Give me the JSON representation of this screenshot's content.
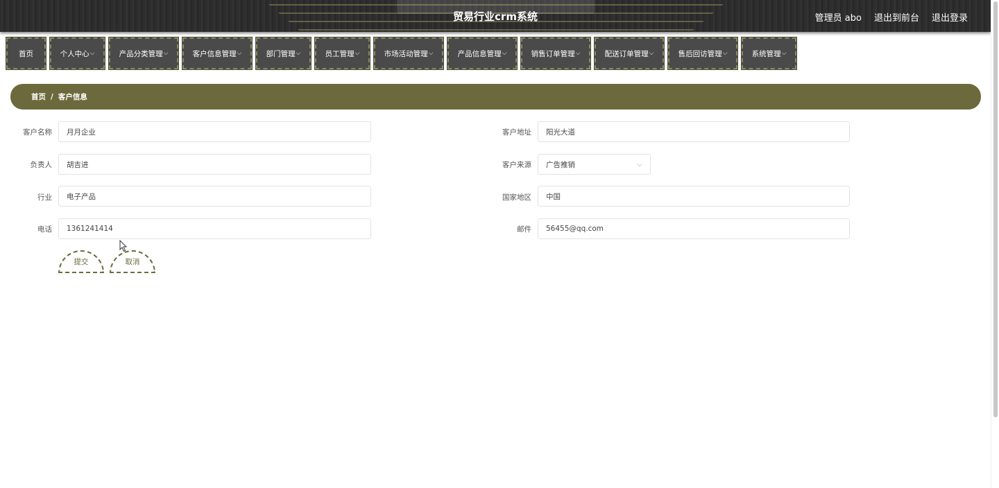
{
  "header": {
    "title": "贸易行业crm系统",
    "admin_label": "管理员 abo",
    "back_to_front": "退出到前台",
    "logout": "退出登录"
  },
  "nav": [
    {
      "label": "首页",
      "has_dropdown": false
    },
    {
      "label": "个人中心",
      "has_dropdown": true
    },
    {
      "label": "产品分类管理",
      "has_dropdown": true
    },
    {
      "label": "客户信息管理",
      "has_dropdown": true
    },
    {
      "label": "部门管理",
      "has_dropdown": true
    },
    {
      "label": "员工管理",
      "has_dropdown": true
    },
    {
      "label": "市场活动管理",
      "has_dropdown": true
    },
    {
      "label": "产品信息管理",
      "has_dropdown": true
    },
    {
      "label": "销售订单管理",
      "has_dropdown": true
    },
    {
      "label": "配送订单管理",
      "has_dropdown": true
    },
    {
      "label": "售后回访管理",
      "has_dropdown": true
    },
    {
      "label": "系统管理",
      "has_dropdown": true
    }
  ],
  "breadcrumb": {
    "home": "首页",
    "separator": "/",
    "current": "客户信息"
  },
  "form": {
    "customer_name": {
      "label": "客户名称",
      "value": "月月企业"
    },
    "customer_address": {
      "label": "客户地址",
      "value": "阳光大道"
    },
    "owner": {
      "label": "负责人",
      "value": "胡吉进"
    },
    "customer_source": {
      "label": "客户来源",
      "value": "广告推销"
    },
    "industry": {
      "label": "行业",
      "value": "电子产品"
    },
    "country_region": {
      "label": "国家地区",
      "value": "中国"
    },
    "phone": {
      "label": "电话",
      "value": "1361241414"
    },
    "email": {
      "label": "邮件",
      "value": "56455@qq.com"
    },
    "submit_label": "提交",
    "cancel_label": "取消"
  },
  "colors": {
    "accent": "#6c6a3c",
    "nav_bg": "#4a4a4a",
    "header_bg": "#2e2e2e"
  }
}
